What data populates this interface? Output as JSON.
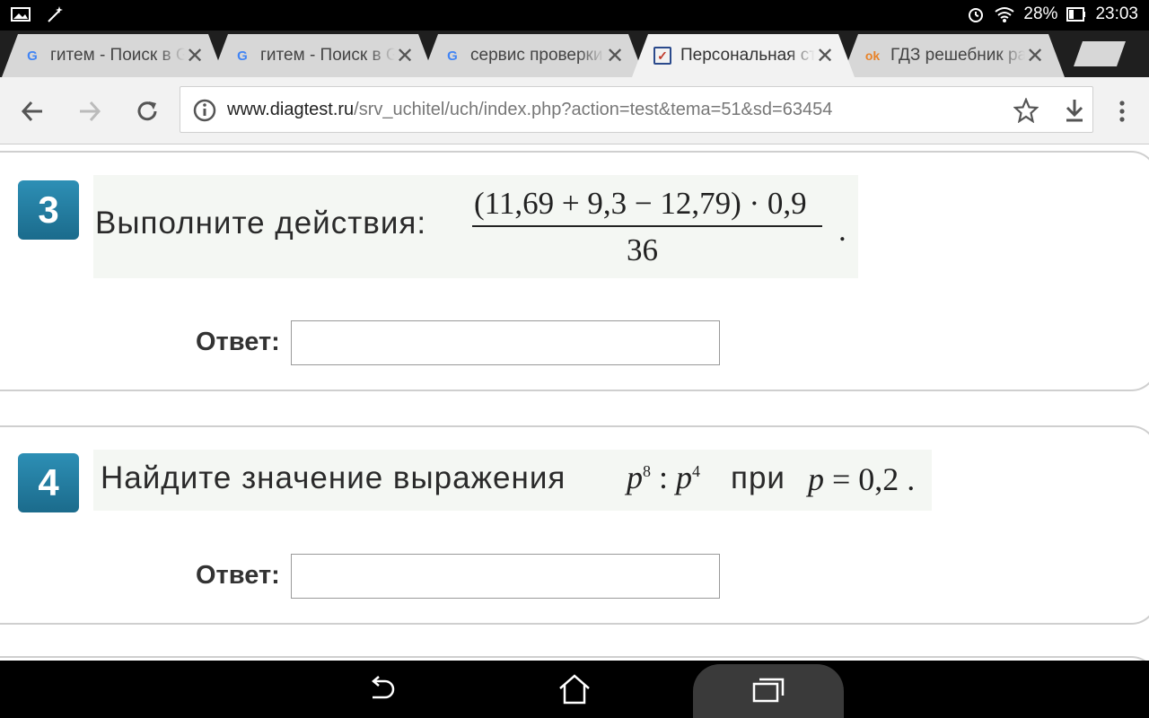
{
  "statusbar": {
    "battery": "28%",
    "time": "23:03"
  },
  "tabs": [
    {
      "title": "гитем - Поиск в Google",
      "favicon": "google-g-icon"
    },
    {
      "title": "гитем - Поиск в Google",
      "favicon": "google-g-icon"
    },
    {
      "title": "сервис проверки знаний",
      "favicon": "google-g-icon"
    },
    {
      "title": "Персональная страница",
      "favicon": "checkbox-favicon-icon"
    },
    {
      "title": "ГДЗ решебник рабочая",
      "favicon": "ok-favicon-icon"
    }
  ],
  "active_tab_index": 3,
  "url": {
    "host": "www.diagtest.ru",
    "path": "/srv_uchitel/uch/index.php?action=test&tema=51&sd=63454"
  },
  "questions": [
    {
      "number": "3",
      "text": "Выполните действия:",
      "numerator": "(11,69 + 9,3 − 12,79) · 0,9",
      "denominator": "36",
      "period": ".",
      "answer_label": "Ответ:"
    },
    {
      "number": "4",
      "text": "Найдите значение выражения",
      "expr_base1": "p",
      "expr_exp1": "8",
      "expr_op": ":",
      "expr_base2": "p",
      "expr_exp2": "4",
      "word_pri": "при",
      "condition_var": "p",
      "condition_rest": " = 0,2 .",
      "answer_label": "Ответ:"
    }
  ],
  "colors": {
    "badge": "#1b6b8c",
    "statusbar": "#000000",
    "tabstrip": "#1f1f1f"
  }
}
